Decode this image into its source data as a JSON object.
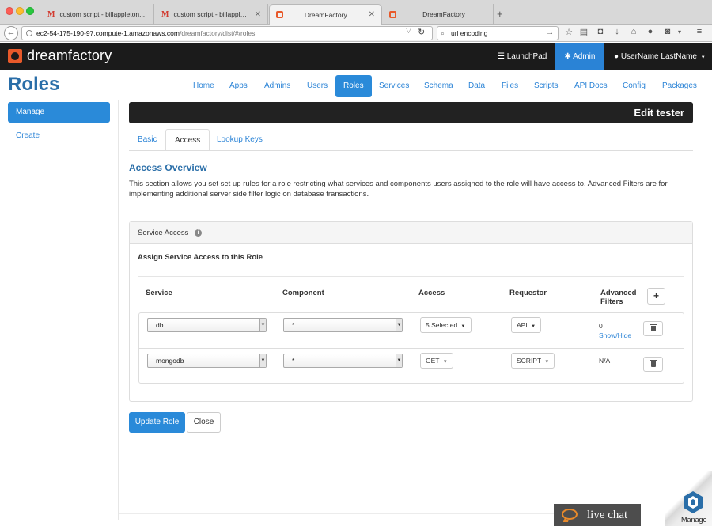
{
  "browser": {
    "tabs": [
      {
        "title": "custom script - billappleton...",
        "icon": "gmail-icon",
        "active": false
      },
      {
        "title": "custom script - billappleton...",
        "icon": "gmail-icon",
        "active": false
      },
      {
        "title": "DreamFactory",
        "icon": "dreamfactory-icon",
        "active": true
      },
      {
        "title": "DreamFactory",
        "icon": "dreamfactory-icon",
        "active": false
      }
    ],
    "url_host": "ec2-54-175-190-97.compute-1.amazonaws.com",
    "url_path": "/dreamfactory/dist/#/roles",
    "search_value": "url encoding"
  },
  "app": {
    "logo": "dreamfactory",
    "launchpad": "LaunchPad",
    "admin": "Admin",
    "user": "UserName LastName"
  },
  "page": {
    "title": "Roles",
    "nav": [
      "Home",
      "Apps",
      "Admins",
      "Users",
      "Roles",
      "Services",
      "Schema",
      "Data",
      "Files",
      "Scripts",
      "API Docs",
      "Config",
      "Packages"
    ],
    "nav_active": "Roles"
  },
  "sidebar": {
    "items": [
      {
        "label": "Manage",
        "active": true
      },
      {
        "label": "Create",
        "active": false
      }
    ]
  },
  "editor": {
    "header": "Edit tester",
    "tabs": [
      "Basic",
      "Access",
      "Lookup Keys"
    ],
    "active_tab": "Access",
    "section_title": "Access Overview",
    "section_desc": "This section allows you set set up rules for a role restricting what services and components users assigned to the role will have access to. Advanced Filters are for implementing additional server side filter logic on database transactions.",
    "panel_title": "Service Access",
    "panel_subtitle": "Assign Service Access to this Role",
    "columns": {
      "service": "Service",
      "component": "Component",
      "access": "Access",
      "requestor": "Requestor",
      "advanced_line1": "Advanced",
      "advanced_line2": "Filters"
    },
    "add_label": "+",
    "rows": [
      {
        "service": "db",
        "component": "*",
        "access": "5 Selected",
        "requestor": "API",
        "filters": "0",
        "filters_link": "Show/Hide"
      },
      {
        "service": "mongodb",
        "component": "*",
        "access": "GET",
        "requestor": "SCRIPT",
        "filters": "N/A",
        "filters_link": ""
      }
    ],
    "update_button": "Update Role",
    "close_button": "Close"
  },
  "widgets": {
    "livechat": "live chat",
    "corner_label": "Manage"
  },
  "colors": {
    "primary": "#2a8ad9",
    "title_blue": "#2a6ea8",
    "header_bg": "#1b1b1b",
    "brand_orange": "#e8592a"
  }
}
